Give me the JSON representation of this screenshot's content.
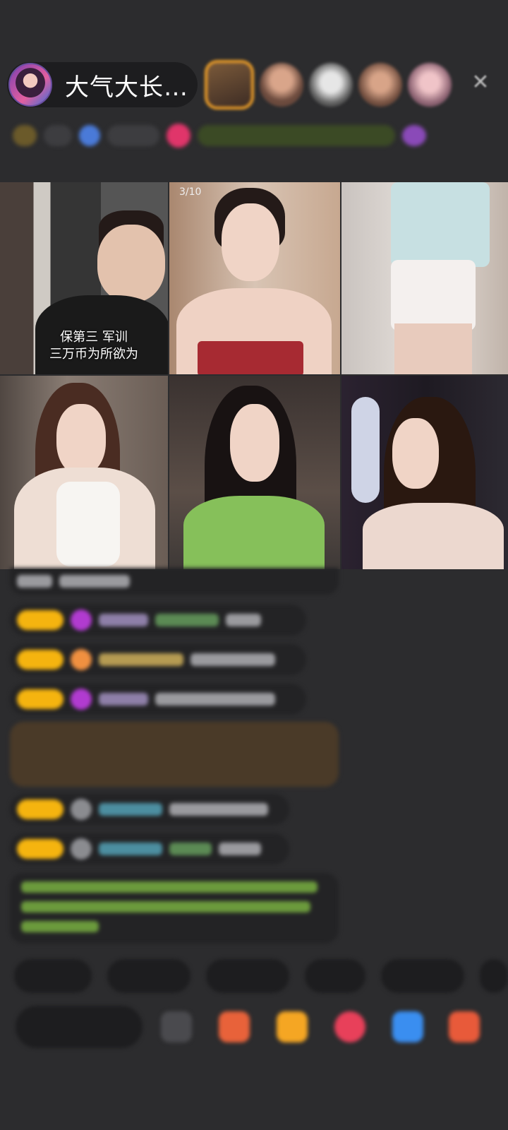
{
  "header": {
    "host_name": "大气大长…",
    "close_icon": "close-icon"
  },
  "grid": {
    "tiles": [
      {
        "caption_line1": "保第三 军训",
        "caption_line2": "三万币为所欲为"
      },
      {
        "pager": "3/10"
      },
      {},
      {},
      {},
      {}
    ]
  },
  "colors": {
    "background": "#2c2c2e",
    "badge": "#f5b40f",
    "pill": "#1d1d1f"
  }
}
